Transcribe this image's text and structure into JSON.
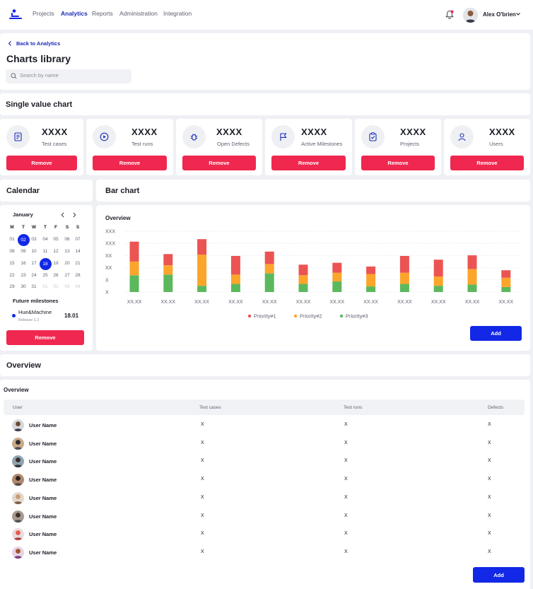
{
  "nav": {
    "items": [
      "Projects",
      "Analytics",
      "Reports",
      "Administration",
      "Integration"
    ],
    "active": "Analytics",
    "user_name": "Alex O'brien"
  },
  "header": {
    "back_label": "Back to Analytics",
    "title": "Charts library",
    "search_placeholder": "Search by name"
  },
  "single_value": {
    "title": "Single value chart",
    "cards": [
      {
        "value": "XXXX",
        "label": "Test cases",
        "icon": "test-cases-icon",
        "button": "Remove"
      },
      {
        "value": "XXXX",
        "label": "Test runs",
        "icon": "play-icon",
        "button": "Remove"
      },
      {
        "value": "XXXX",
        "label": "Open Defects",
        "icon": "bug-icon",
        "button": "Remove"
      },
      {
        "value": "XXXX",
        "label": "Active Milestones",
        "icon": "flag-icon",
        "button": "Remove"
      },
      {
        "value": "XXXX",
        "label": "Projects",
        "icon": "clipboard-check-icon",
        "button": "Remove"
      },
      {
        "value": "XXXX",
        "label": "Users",
        "icon": "user-icon",
        "button": "Remove"
      }
    ]
  },
  "calendar": {
    "title": "Calendar",
    "month": "January",
    "weekdays": [
      "M",
      "T",
      "W",
      "T",
      "F",
      "S",
      "S"
    ],
    "weeks": [
      [
        "01",
        "02",
        "03",
        "04",
        "05",
        "06",
        "07"
      ],
      [
        "08",
        "09",
        "10",
        "11",
        "12",
        "13",
        "14"
      ],
      [
        "15",
        "16",
        "17",
        "18",
        "19",
        "20",
        "21"
      ],
      [
        "22",
        "23",
        "24",
        "25",
        "26",
        "27",
        "28"
      ],
      [
        "29",
        "30",
        "31",
        "01",
        "02",
        "03",
        "04"
      ]
    ],
    "selected": [
      "02",
      "18"
    ],
    "future_title": "Future milestones",
    "milestone": {
      "name": "Hue&Machine",
      "sub": "Release 1.2",
      "date": "18.01"
    },
    "button": "Remove"
  },
  "bar_chart": {
    "title": "Bar chart",
    "button": "Add"
  },
  "chart_data": {
    "type": "bar",
    "stacked": true,
    "title": "Overview",
    "categories": [
      "XX.XX",
      "XX.XX",
      "XX.XX",
      "XX.XX",
      "XX.XX",
      "XX.XX",
      "XX.XX",
      "XX.XX",
      "XX.XX",
      "XX.XX",
      "XX.XX",
      "XX.XX"
    ],
    "y_tick_labels": [
      "XXX",
      "XXX",
      "XX",
      "XX",
      "X",
      "X"
    ],
    "ylim": [
      0,
      100
    ],
    "grid": true,
    "legend_position": "bottom",
    "series": [
      {
        "name": "Priority#3",
        "color": "#5cb85c",
        "values": [
          27,
          28,
          10,
          13,
          30,
          13,
          17,
          9,
          13,
          10,
          12,
          8
        ]
      },
      {
        "name": "Priority#2",
        "color": "#fca52b",
        "values": [
          22,
          15,
          50,
          15,
          15,
          14,
          14,
          20,
          18,
          15,
          25,
          15
        ]
      },
      {
        "name": "Priority#1",
        "color": "#ec5453",
        "values": [
          32,
          18,
          25,
          30,
          20,
          17,
          16,
          12,
          27,
          27,
          22,
          12
        ]
      }
    ]
  },
  "overview": {
    "section_title": "Overview",
    "card_title": "Overview",
    "columns": [
      "User",
      "Test cases",
      "Test runs",
      "Defects"
    ],
    "rows": [
      {
        "user": "User Name",
        "test_cases": "X",
        "test_runs": "X",
        "defects": "X"
      },
      {
        "user": "User Name",
        "test_cases": "X",
        "test_runs": "X",
        "defects": "X"
      },
      {
        "user": "User Name",
        "test_cases": "X",
        "test_runs": "X",
        "defects": "X"
      },
      {
        "user": "User Name",
        "test_cases": "X",
        "test_runs": "X",
        "defects": "X"
      },
      {
        "user": "User Name",
        "test_cases": "X",
        "test_runs": "X",
        "defects": "X"
      },
      {
        "user": "User Name",
        "test_cases": "X",
        "test_runs": "X",
        "defects": "X"
      },
      {
        "user": "User Name",
        "test_cases": "X",
        "test_runs": "X",
        "defects": "X"
      },
      {
        "user": "User Name",
        "test_cases": "X",
        "test_runs": "X",
        "defects": "X"
      }
    ],
    "button": "Add"
  }
}
